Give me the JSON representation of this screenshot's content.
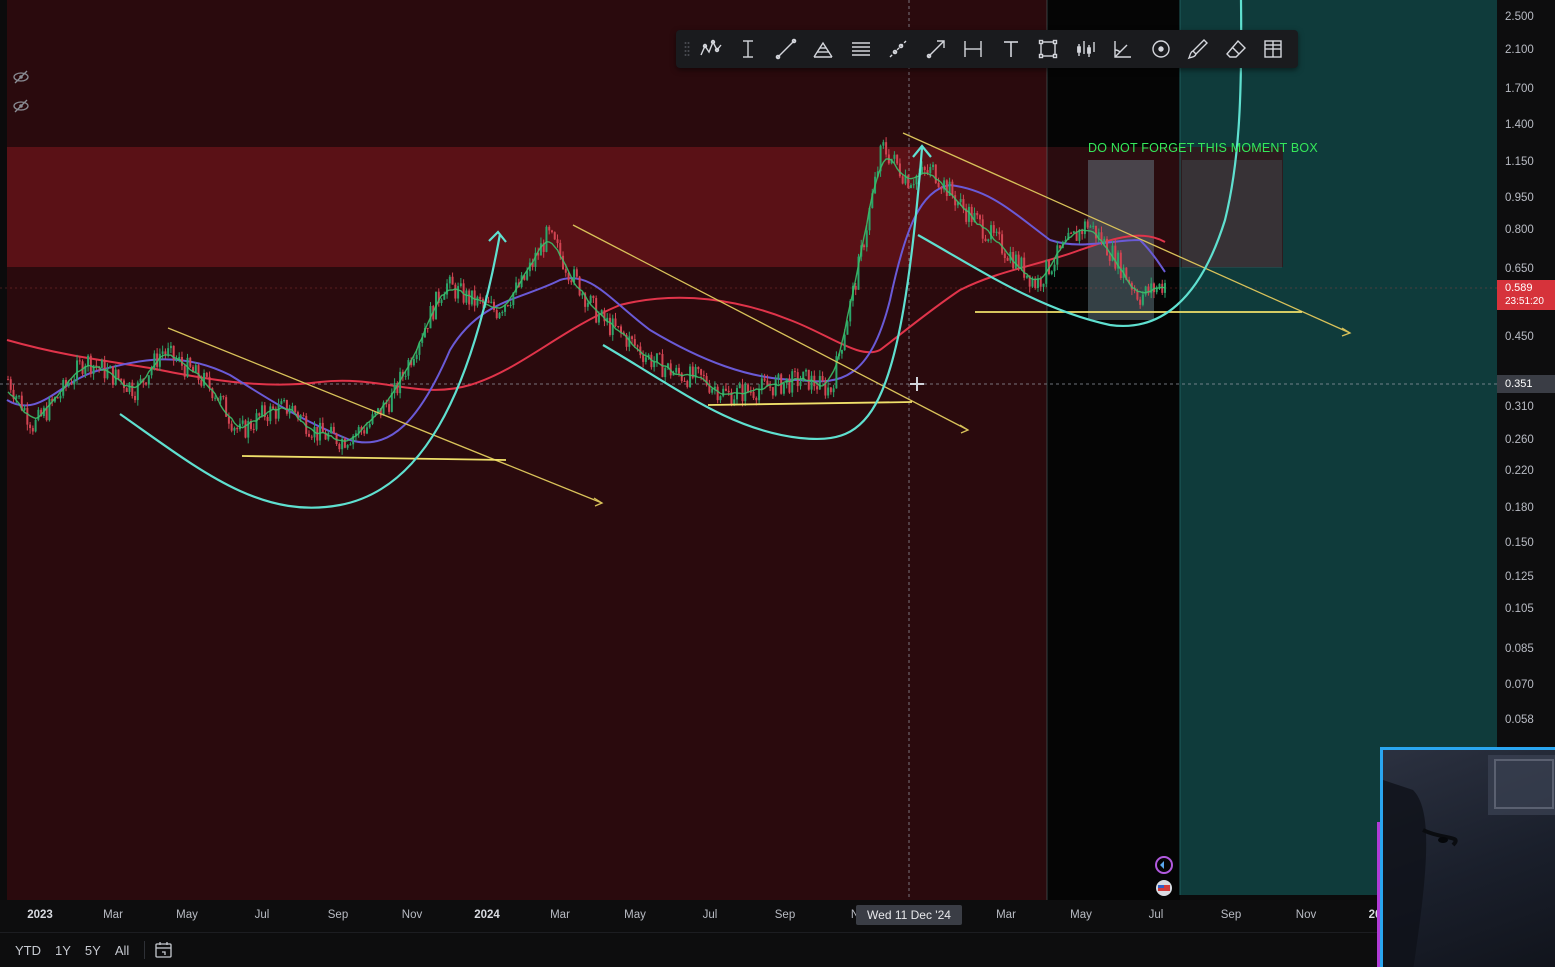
{
  "chart_data": {
    "type": "candlestick-line",
    "scale": "log",
    "price_axis_ticks": [
      "2.500",
      "2.100",
      "1.700",
      "1.400",
      "1.150",
      "0.950",
      "0.800",
      "0.650",
      "0.450",
      "0.310",
      "0.260",
      "0.220",
      "0.180",
      "0.150",
      "0.125",
      "0.105",
      "0.085",
      "0.070",
      "0.058"
    ],
    "price_axis_values": [
      2.5,
      2.1,
      1.7,
      1.4,
      1.15,
      0.95,
      0.8,
      0.65,
      0.45,
      0.31,
      0.26,
      0.22,
      0.18,
      0.15,
      0.125,
      0.105,
      0.085,
      0.07,
      0.058
    ],
    "time_axis_ticks": [
      {
        "label": "2023",
        "bold": true
      },
      {
        "label": "Mar",
        "bold": false
      },
      {
        "label": "May",
        "bold": false
      },
      {
        "label": "Jul",
        "bold": false
      },
      {
        "label": "Sep",
        "bold": false
      },
      {
        "label": "Nov",
        "bold": false
      },
      {
        "label": "2024",
        "bold": true
      },
      {
        "label": "Mar",
        "bold": false
      },
      {
        "label": "May",
        "bold": false
      },
      {
        "label": "Jul",
        "bold": false
      },
      {
        "label": "Sep",
        "bold": false
      },
      {
        "label": "N",
        "bold": false
      },
      {
        "label": "Mar",
        "bold": false
      },
      {
        "label": "May",
        "bold": false
      },
      {
        "label": "Jul",
        "bold": false
      },
      {
        "label": "Sep",
        "bold": false
      },
      {
        "label": "Nov",
        "bold": false
      },
      {
        "label": "20",
        "bold": true
      }
    ],
    "price_path": [
      0.36,
      0.28,
      0.33,
      0.4,
      0.37,
      0.34,
      0.42,
      0.38,
      0.34,
      0.27,
      0.3,
      0.31,
      0.27,
      0.26,
      0.28,
      0.33,
      0.45,
      0.6,
      0.55,
      0.52,
      0.6,
      0.78,
      0.62,
      0.5,
      0.45,
      0.4,
      0.37,
      0.36,
      0.33,
      0.34,
      0.35,
      0.36,
      0.34,
      0.62,
      1.25,
      1.05,
      1.1,
      0.92,
      0.8,
      0.7,
      0.6,
      0.72,
      0.83,
      0.7,
      0.56,
      0.6
    ],
    "price_path_start": "2023-01",
    "price_path_end": "2025-06",
    "current_price": "0.589",
    "countdown": "23:51:20",
    "crosshair_price": "0.351",
    "crosshair_date": "Wed 11 Dec '24",
    "colors": {
      "price": "#3cbf6a",
      "ma_fast": "#6a5ad6",
      "ma_slow": "#e0344a",
      "trendline": "#d9c25a",
      "support": "#f0e06a",
      "cup_curve": "#5fe0d0",
      "resistance_zone": "#7a1218",
      "background_left": "#2a0a0d",
      "background_right": "#0f3b3b",
      "annotation": "#35e85a"
    }
  },
  "annotation": {
    "text": "DO NOT FORGET THIS MOMENT BOX"
  },
  "drawing_toolbar": {
    "tools": [
      {
        "name": "pattern-tool-icon"
      },
      {
        "name": "text-cursor-icon"
      },
      {
        "name": "trend-line-icon"
      },
      {
        "name": "fib-tool-icon"
      },
      {
        "name": "horizontal-lines-icon"
      },
      {
        "name": "ray-icon"
      },
      {
        "name": "arrow-line-icon"
      },
      {
        "name": "measure-icon"
      },
      {
        "name": "text-icon"
      },
      {
        "name": "rectangle-icon"
      },
      {
        "name": "bars-pattern-icon"
      },
      {
        "name": "angle-icon"
      },
      {
        "name": "circle-target-icon"
      },
      {
        "name": "brush-icon"
      },
      {
        "name": "eraser-icon"
      },
      {
        "name": "grid-icon"
      }
    ]
  },
  "bottom_bar": {
    "ranges": [
      "YTD",
      "1Y",
      "5Y",
      "All"
    ]
  }
}
